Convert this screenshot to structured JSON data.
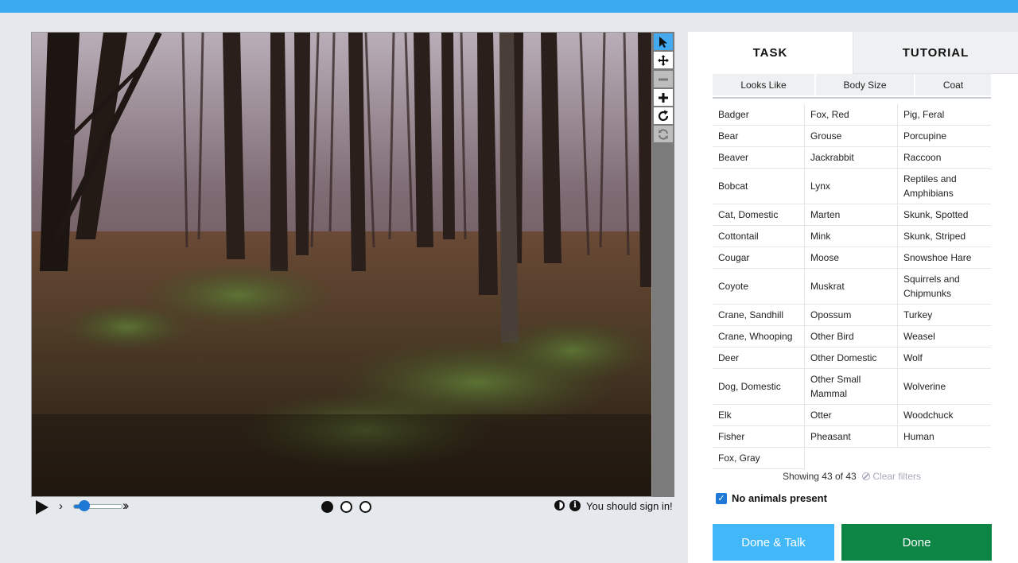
{
  "viewer": {
    "image_description_icon": "trail-camera-photo",
    "tools": [
      {
        "icon": "pointer-icon",
        "state": "active"
      },
      {
        "icon": "move-icon",
        "state": "normal"
      },
      {
        "icon": "zoom-out-icon",
        "state": "disabled"
      },
      {
        "icon": "zoom-in-icon",
        "state": "normal"
      },
      {
        "icon": "rotate-icon",
        "state": "normal"
      },
      {
        "icon": "reset-icon",
        "state": "disabled"
      }
    ]
  },
  "player": {
    "speed_fraction": 0.2,
    "frames": 3,
    "current_frame": 1,
    "signin_text": "You should sign in!"
  },
  "tabs": {
    "task": "TASK",
    "tutorial": "TUTORIAL"
  },
  "filters": [
    "Looks Like",
    "Body Size",
    "Coat"
  ],
  "choices": [
    [
      "Badger",
      "Fox, Red",
      "Pig, Feral"
    ],
    [
      "Bear",
      "Grouse",
      "Porcupine"
    ],
    [
      "Beaver",
      "Jackrabbit",
      "Raccoon"
    ],
    [
      "Bobcat",
      "Lynx",
      "Reptiles and Amphibians"
    ],
    [
      "Cat, Domestic",
      "Marten",
      "Skunk, Spotted"
    ],
    [
      "Cottontail",
      "Mink",
      "Skunk, Striped"
    ],
    [
      "Cougar",
      "Moose",
      "Snowshoe Hare"
    ],
    [
      "Coyote",
      "Muskrat",
      "Squirrels and Chipmunks"
    ],
    [
      "Crane, Sandhill",
      "Opossum",
      "Turkey"
    ],
    [
      "Crane, Whooping",
      "Other Bird",
      "Weasel"
    ],
    [
      "Deer",
      "Other Domestic",
      "Wolf"
    ],
    [
      "Dog, Domestic",
      "Other Small Mammal",
      "Wolverine"
    ],
    [
      "Elk",
      "Otter",
      "Woodchuck"
    ],
    [
      "Fisher",
      "Pheasant",
      "Human"
    ],
    [
      "Fox, Gray",
      "",
      ""
    ]
  ],
  "showing_text": "Showing 43 of 43",
  "clear_filters": "Clear filters",
  "no_animals": {
    "label": "No animals present",
    "checked": true
  },
  "buttons": {
    "done_talk": "Done & Talk",
    "done": "Done"
  },
  "colors": {
    "accent": "#3baaf0",
    "done": "#0d8645",
    "done_talk": "#43b8f8"
  }
}
